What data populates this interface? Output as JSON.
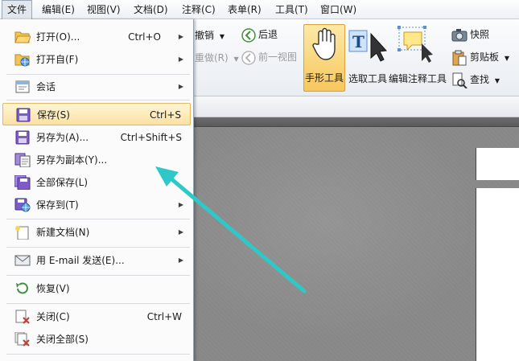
{
  "menubar": {
    "items": [
      {
        "label": "文件"
      },
      {
        "label": "编辑(E)"
      },
      {
        "label": "视图(V)"
      },
      {
        "label": "文档(D)"
      },
      {
        "label": "注释(C)"
      },
      {
        "label": "表单(R)"
      },
      {
        "label": "工具(T)"
      },
      {
        "label": "窗口(W)"
      }
    ]
  },
  "ribbon": {
    "undo": "撤销",
    "redo": "重做(R)",
    "back": "后退",
    "prev_view": "前一视图",
    "hand_tool": "手形工具",
    "select_tool": "选取工具",
    "annotate_tool": "编辑注释工具",
    "snapshot": "快照",
    "clipboard": "剪贴板",
    "find": "查找"
  },
  "file_menu": {
    "open": {
      "label": "打开(O)...",
      "shortcut": "Ctrl+O"
    },
    "open_from": {
      "label": "打开自(F)"
    },
    "session": {
      "label": "会话"
    },
    "save": {
      "label": "保存(S)",
      "shortcut": "Ctrl+S"
    },
    "save_as": {
      "label": "另存为(A)...",
      "shortcut": "Ctrl+Shift+S"
    },
    "save_copy": {
      "label": "另存为副本(Y)..."
    },
    "save_all": {
      "label": "全部保存(L)"
    },
    "save_to": {
      "label": "保存到(T)"
    },
    "new_doc": {
      "label": "新建文档(N)"
    },
    "email": {
      "label": "用 E-mail 发送(E)..."
    },
    "restore": {
      "label": "恢复(V)"
    },
    "close": {
      "label": "关闭(C)",
      "shortcut": "Ctrl+W"
    },
    "close_all": {
      "label": "关闭全部(S)"
    }
  },
  "colors": {
    "highlight": "#fbe1a0",
    "arrow": "#2fc8c8",
    "hand_tool_selected": "#f6c75d"
  }
}
